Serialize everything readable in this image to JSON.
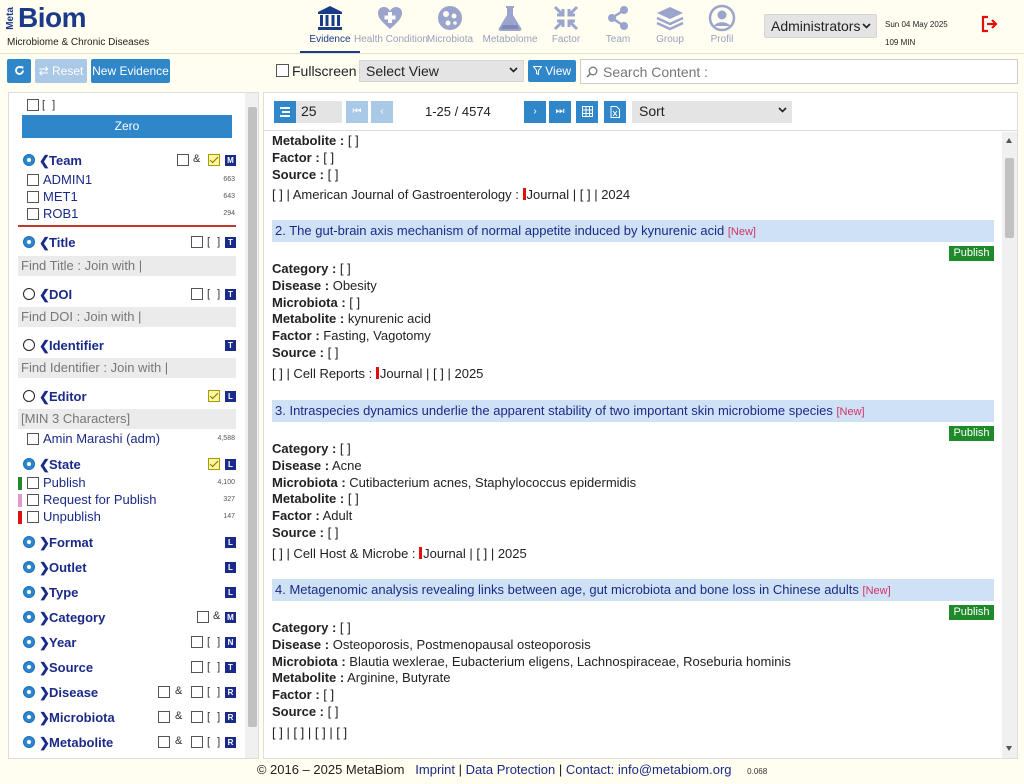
{
  "brand": {
    "logo_prefix": "Meta",
    "logo_main": "Biom",
    "subtitle": "Microbiome & Chronic Diseases",
    "accent_color": "#1a3a8a"
  },
  "nav": [
    {
      "label": "Evidence",
      "icon": "building-icon",
      "active": true
    },
    {
      "label": "Health Condition",
      "icon": "health-icon",
      "active": false
    },
    {
      "label": "Microbiota",
      "icon": "microbe-icon",
      "active": false
    },
    {
      "label": "Metabolome",
      "icon": "flask-icon",
      "active": false
    },
    {
      "label": "Factor",
      "icon": "compress-icon",
      "active": false
    },
    {
      "label": "Team",
      "icon": "share-icon",
      "active": false
    },
    {
      "label": "Group",
      "icon": "layers-icon",
      "active": false
    },
    {
      "label": "Profil",
      "icon": "user-icon",
      "active": false
    }
  ],
  "header": {
    "user_role": "Administrators",
    "date": "Sun 04 May 2025",
    "session": "109 MIN"
  },
  "actions": {
    "reset_label": "Reset",
    "new_evidence_label": "New Evidence",
    "fullscreen_label": "Fullscreen",
    "select_view": "Select View",
    "view_label": "View",
    "search_placeholder": "Search Content :"
  },
  "sidebar": {
    "top_bracket": "[ ]",
    "zero_label": "Zero",
    "team": {
      "title": "Team",
      "amp": "&",
      "tag": "M",
      "items": [
        {
          "label": "ADMIN1",
          "count": "663"
        },
        {
          "label": "MET1",
          "count": "643"
        },
        {
          "label": "ROB1",
          "count": "294"
        }
      ]
    },
    "title_sec": {
      "title": "Title",
      "bracket": "[ ]",
      "tag": "T",
      "find": "Find Title :  Join with |"
    },
    "doi_sec": {
      "title": "DOI",
      "bracket": "[ ]",
      "tag": "T",
      "find": "Find DOI :  Join with |"
    },
    "identifier_sec": {
      "title": "Identifier",
      "tag": "T",
      "find": "Find Identifier :  Join with |"
    },
    "editor_sec": {
      "title": "Editor",
      "tag": "L",
      "find": "[MIN 3  Characters]",
      "items": [
        {
          "label": "Amin Marashi (adm)",
          "count": "4,588"
        }
      ]
    },
    "state_sec": {
      "title": "State",
      "tag": "L",
      "items": [
        {
          "label": "Publish",
          "count": "4,100",
          "color": "#1e8a2a"
        },
        {
          "label": "Request for Publish",
          "count": "327",
          "color": "#e09ad0"
        },
        {
          "label": "Unpublish",
          "count": "147",
          "color": "#e01010"
        }
      ]
    },
    "collapsed": [
      {
        "title": "Format",
        "tag": "L"
      },
      {
        "title": "Outlet",
        "tag": "L"
      },
      {
        "title": "Type",
        "tag": "L"
      },
      {
        "title": "Category",
        "amp": "&",
        "tag": "M"
      },
      {
        "title": "Year",
        "bracket": "[ ]",
        "tag": "N"
      },
      {
        "title": "Source",
        "bracket": "[ ]",
        "tag": "T"
      },
      {
        "title": "Disease",
        "amp": "&",
        "bracket": "[ ]",
        "tag": "R"
      },
      {
        "title": "Microbiota",
        "amp": "&",
        "bracket": "[ ]",
        "tag": "R"
      },
      {
        "title": "Metabolite",
        "amp": "&",
        "bracket": "[ ]",
        "tag": "R"
      }
    ]
  },
  "results": {
    "page_size": "25",
    "range": "1-25 / 4574",
    "sort_label": "Sort"
  },
  "evidence_labels": {
    "category": "Category :",
    "disease": "Disease :",
    "microbiota": "Microbiota :",
    "metabolite": "Metabolite :",
    "factor": "Factor :",
    "source": "Source :",
    "new_badge": "[New]",
    "publish_badge": "Publish"
  },
  "evidence_partial": {
    "metabolite": "[  ]",
    "factor": "[  ]",
    "source": "[  ]",
    "ref_pre": "[  ] | American Journal of Gastroenterology :",
    "ref_post": "Journal | [  ] | 2024"
  },
  "evidence": [
    {
      "title": "2. The gut-brain axis mechanism of normal appetite induced by kynurenic acid",
      "category": "[  ]",
      "disease": "Obesity",
      "microbiota": "[  ]",
      "metabolite": "kynurenic acid",
      "factor": "Fasting, Vagotomy",
      "source": "[  ]",
      "ref_pre": "[  ] | Cell Reports :",
      "ref_post": "Journal | [  ] | 2025"
    },
    {
      "title": "3. Intraspecies dynamics underlie the apparent stability of two important skin microbiome species",
      "category": "[  ]",
      "disease": "Acne",
      "microbiota": "Cutibacterium acnes, Staphylococcus epidermidis",
      "metabolite": "[  ]",
      "factor": "Adult",
      "source": "[  ]",
      "ref_pre": "[  ] | Cell Host & Microbe :",
      "ref_post": "Journal | [  ] | 2025"
    },
    {
      "title": "4. Metagenomic analysis revealing links between age, gut microbiota and bone loss in Chinese adults",
      "category": "[  ]",
      "disease": "Osteoporosis, Postmenopausal osteoporosis",
      "microbiota": "Blautia wexlerae, Eubacterium eligens, Lachnospiraceae, Roseburia hominis",
      "metabolite": "Arginine, Butyrate",
      "factor": "[  ]",
      "source": "[  ]",
      "ref_plain": "[  ] | [  ] | [  ] | [  ]"
    }
  ],
  "footer": {
    "copyright": "© 2016 – 2025 MetaBiom",
    "imprint": "Imprint",
    "data_protection": "Data Protection",
    "contact_label": "Contact:",
    "email": "info@metabiom.org",
    "version": "0.068"
  }
}
